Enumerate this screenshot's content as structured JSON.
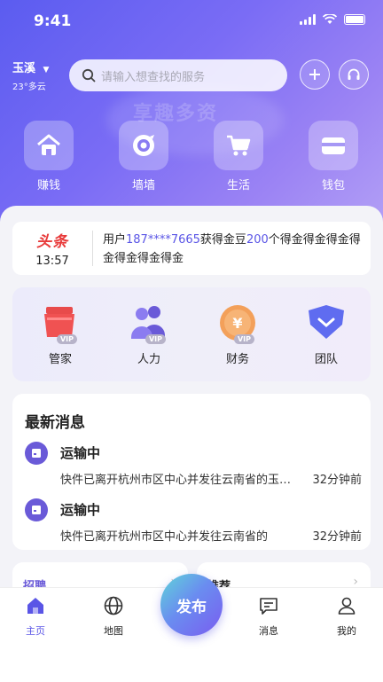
{
  "status_bar": {
    "time": "9:41"
  },
  "header": {
    "city": "玉溪",
    "weather": "23°多云",
    "search_placeholder": "请输入想查找的服务",
    "hero_watermark": "享趣多资"
  },
  "quick_actions": [
    {
      "label": "赚钱",
      "icon": "home-icon"
    },
    {
      "label": "墙墙",
      "icon": "target-icon"
    },
    {
      "label": "生活",
      "icon": "cart-icon"
    },
    {
      "label": "钱包",
      "icon": "wallet-icon"
    }
  ],
  "news": {
    "badge": "头条",
    "time": "13:57",
    "prefix": "用户",
    "user": "187****7665",
    "middle": "获得金豆",
    "amount": "200",
    "suffix": "个得金得金得金得金得金得金得金"
  },
  "categories": [
    {
      "label": "管家",
      "badge": "VIP",
      "icon": "shop-icon"
    },
    {
      "label": "人力",
      "badge": "VIP",
      "icon": "users-icon"
    },
    {
      "label": "财务",
      "badge": "VIP",
      "icon": "yen-icon"
    },
    {
      "label": "团队",
      "badge": "",
      "icon": "team-shield-icon"
    }
  ],
  "messages": {
    "title": "最新消息",
    "items": [
      {
        "status": "运输中",
        "desc": "快件已离开杭州市区中心并发往云南省的玉溪市",
        "ago": "32分钟前"
      },
      {
        "status": "运输中",
        "desc": "快件已离开杭州市区中心并发往云南省的",
        "ago": "32分钟前"
      }
    ]
  },
  "bottom_cards": [
    {
      "title": "招聘"
    },
    {
      "title": "推荐"
    }
  ],
  "tabbar": {
    "items": [
      {
        "label": "主页",
        "icon": "home-icon",
        "active": true
      },
      {
        "label": "地图",
        "icon": "globe-icon",
        "active": false
      },
      {
        "label": "消息",
        "icon": "chat-icon",
        "active": false
      },
      {
        "label": "我的",
        "icon": "user-icon",
        "active": false
      }
    ],
    "publish_label": "发布"
  },
  "colors": {
    "accent": "#5a55e6",
    "hero_start": "#5b5cf0",
    "hero_end": "#b8a6f6",
    "news_red": "#e83a3a"
  }
}
